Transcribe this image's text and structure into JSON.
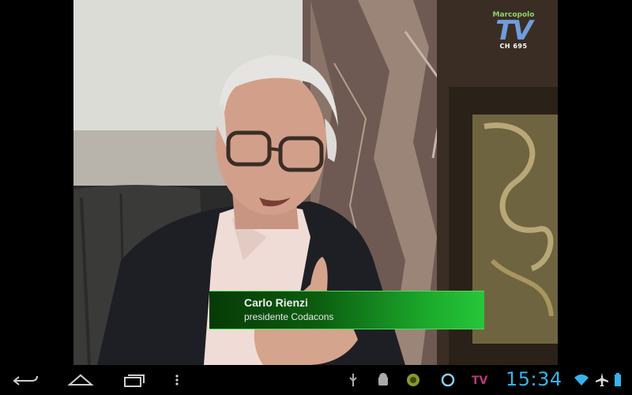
{
  "tv_logo": {
    "text": "TV",
    "brand": "Marcopolo",
    "channel": "CH 695"
  },
  "lower_third": {
    "name": "Carlo Rienzi",
    "title": "presidente Codacons"
  },
  "status_bar": {
    "time": "15:34",
    "accent_color": "#36b3ea"
  },
  "nav": {
    "icons": [
      "back-icon",
      "home-icon",
      "recent-apps-icon",
      "menu-icon"
    ]
  },
  "notifications": {
    "icons": [
      "usb-icon",
      "android-debug-icon",
      "app-icon",
      "refresh-icon",
      "tv-app-icon"
    ]
  },
  "system_icons": [
    "wifi-icon",
    "airplane-mode-icon",
    "battery-icon"
  ]
}
